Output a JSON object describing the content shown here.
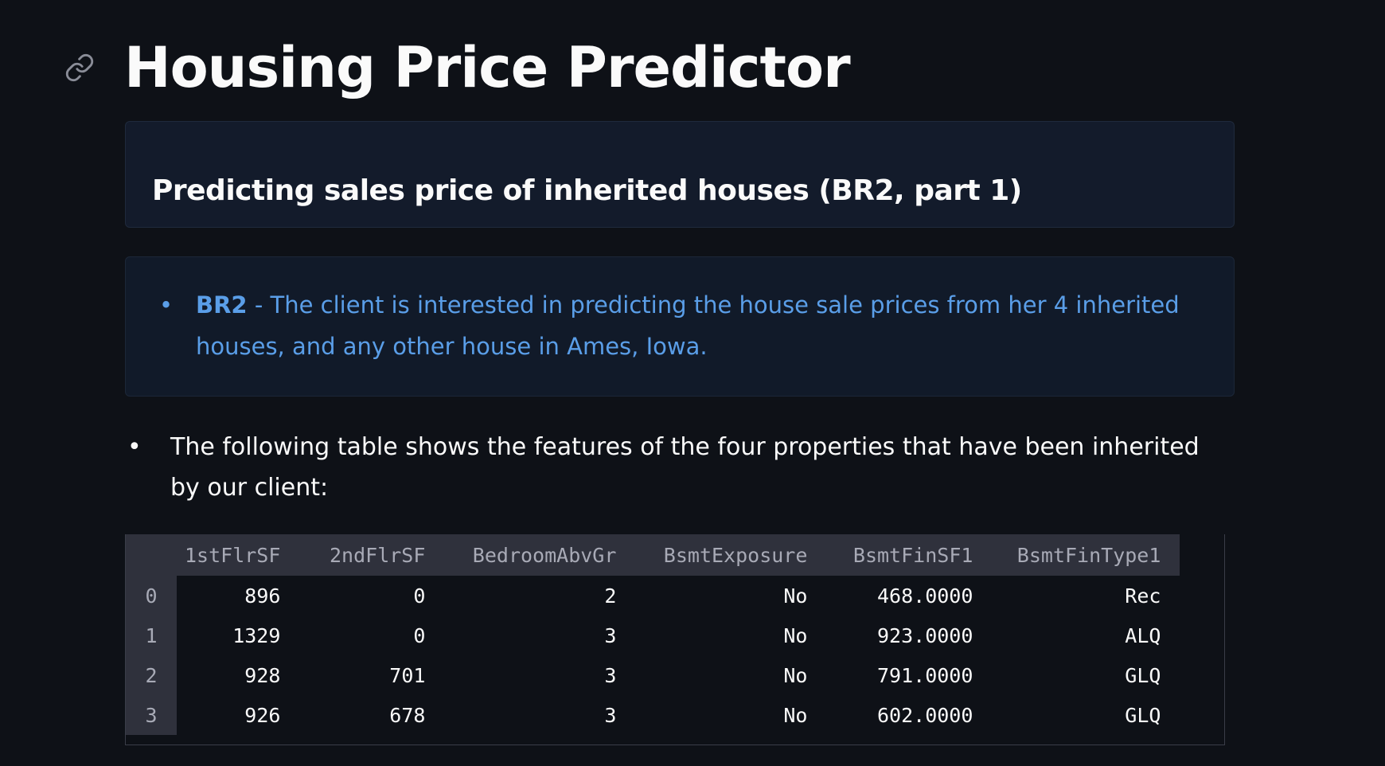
{
  "page": {
    "title": "Housing Price Predictor",
    "subheader": "Predicting sales price of inherited houses (BR2, part 1)"
  },
  "info": {
    "label": "BR2",
    "separator": " - ",
    "text": "The client is interested in predicting the house sale prices from her 4 inherited houses, and any other house in Ames, Iowa."
  },
  "paragraph": {
    "text": "The following table shows the features of the four properties that have been inherited by our client:"
  },
  "table": {
    "columns": [
      "1stFlrSF",
      "2ndFlrSF",
      "BedroomAbvGr",
      "BsmtExposure",
      "BsmtFinSF1",
      "BsmtFinType1"
    ],
    "rows": [
      {
        "index": "0",
        "cells": [
          "896",
          "0",
          "2",
          "No",
          "468.0000",
          "Rec"
        ]
      },
      {
        "index": "1",
        "cells": [
          "1329",
          "0",
          "3",
          "No",
          "923.0000",
          "ALQ"
        ]
      },
      {
        "index": "2",
        "cells": [
          "928",
          "701",
          "3",
          "No",
          "791.0000",
          "GLQ"
        ]
      },
      {
        "index": "3",
        "cells": [
          "926",
          "678",
          "3",
          "No",
          "602.0000",
          "GLQ"
        ]
      }
    ]
  },
  "icons": {
    "anchor": "link-icon",
    "bullet": "bullet-dot"
  },
  "colors": {
    "background": "#0e1117",
    "info_text": "#5a9ee8",
    "table_header_bg": "#2f313c"
  }
}
